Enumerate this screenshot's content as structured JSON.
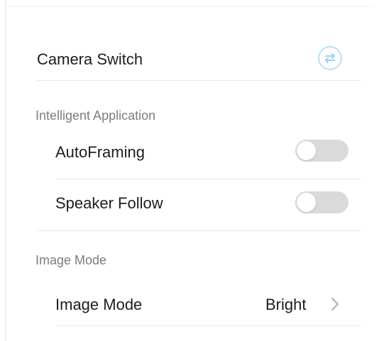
{
  "camera_switch": {
    "label": "Camera Switch",
    "icon": "swap-arrows-icon"
  },
  "intelligent_application": {
    "section_title": "Intelligent Application",
    "items": [
      {
        "label": "AutoFraming",
        "enabled": false
      },
      {
        "label": "Speaker Follow",
        "enabled": false
      }
    ]
  },
  "image_mode": {
    "section_title": "Image Mode",
    "item_label": "Image Mode",
    "value": "Bright",
    "icon": "chevron-right-icon"
  },
  "colors": {
    "toggle_off_track": "#dadada",
    "accent_icon": "#b9def3",
    "section_title": "#7d7d7d",
    "divider": "#e8e8e8"
  }
}
